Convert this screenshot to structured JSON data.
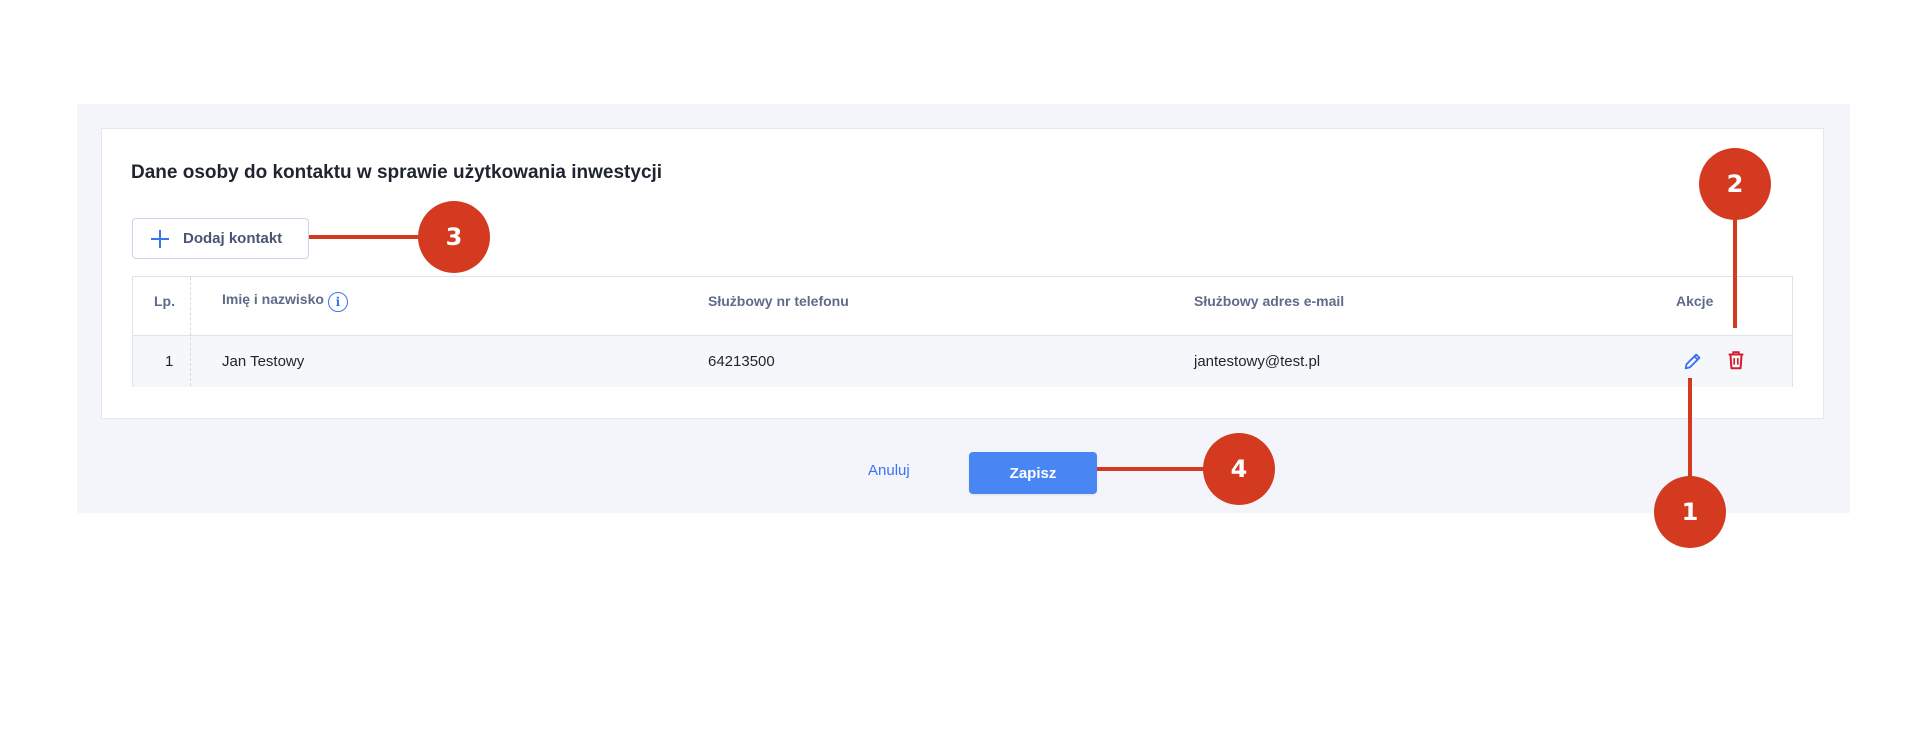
{
  "section": {
    "title": "Dane osoby do kontaktu w sprawie użytkowania inwestycji"
  },
  "add_contact": {
    "label": "Dodaj kontakt",
    "icon": "plus-icon"
  },
  "table": {
    "headers": {
      "lp": "Lp.",
      "name": "Imię i nazwisko",
      "phone": "Służbowy nr telefonu",
      "email": "Służbowy adres e-mail",
      "actions": "Akcje"
    },
    "rows": [
      {
        "lp": "1",
        "name": "Jan Testowy",
        "phone": "64213500",
        "email": "jantestowy@test.pl"
      }
    ]
  },
  "footer": {
    "cancel_label": "Anuluj",
    "save_label": "Zapisz"
  },
  "callouts": {
    "c1": "1",
    "c2": "2",
    "c3": "3",
    "c4": "4"
  },
  "colors": {
    "accent": "#3b74f0",
    "danger": "#d0202f",
    "callout": "#d33a20",
    "panel_bg": "#f3f5fa"
  },
  "icons": {
    "info": "info-icon",
    "edit": "pencil-icon",
    "delete": "trash-icon"
  }
}
